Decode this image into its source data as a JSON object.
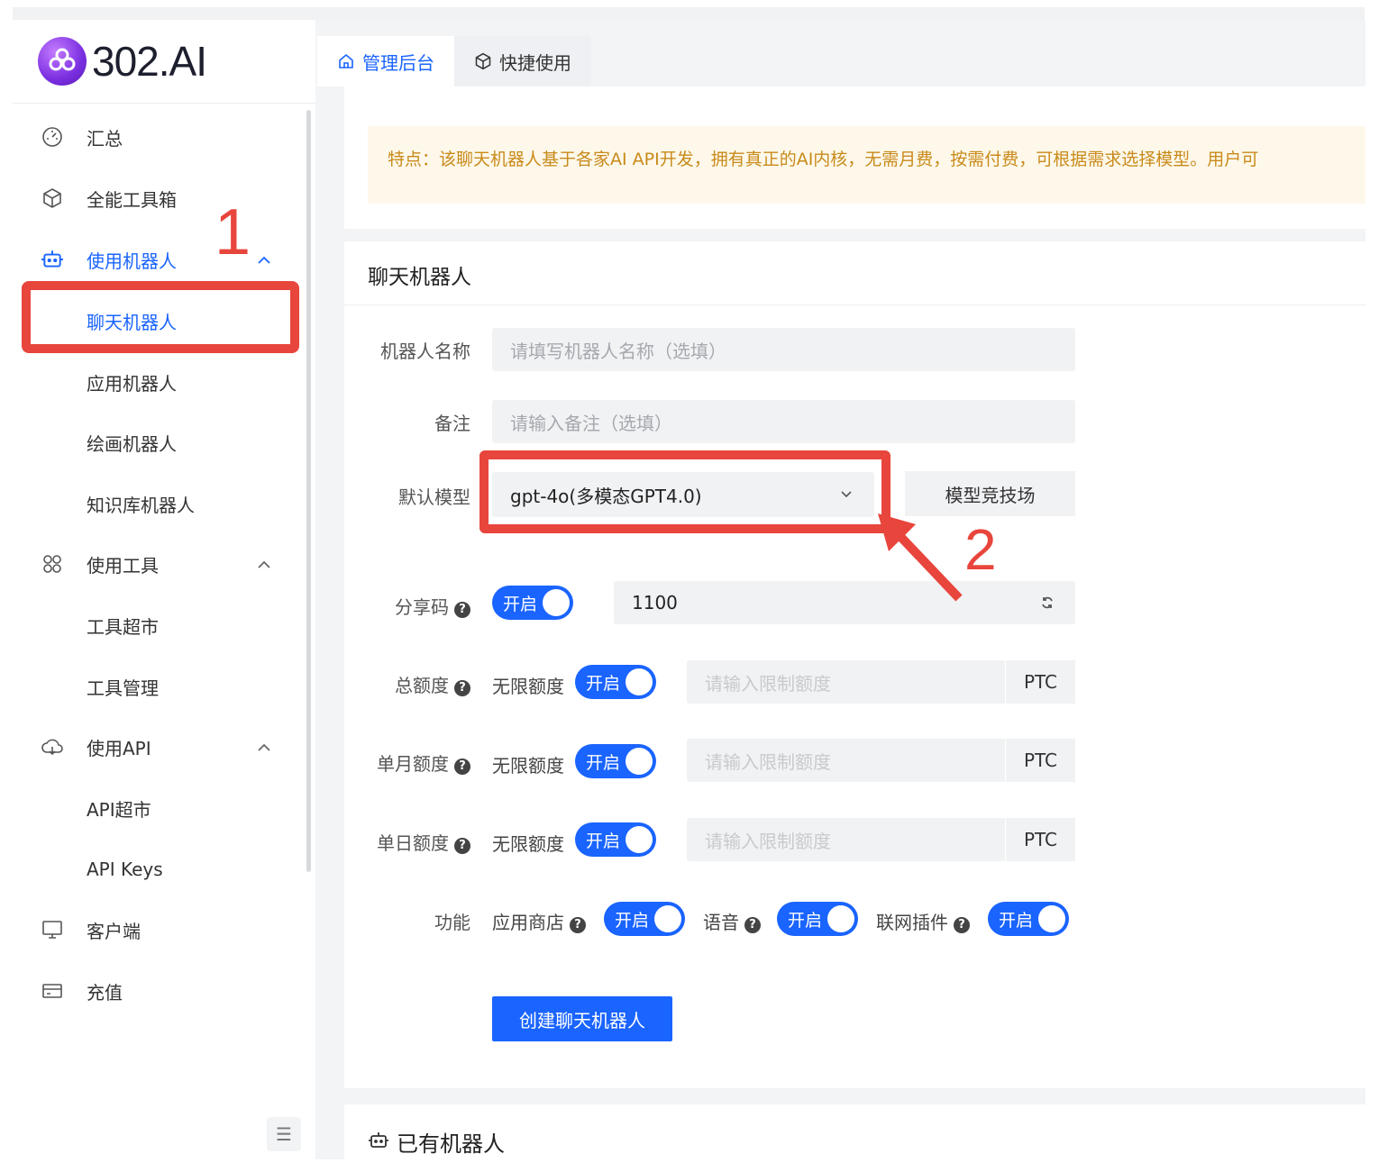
{
  "brand": {
    "name": "302.AI",
    "accent": "#1a64ff",
    "annotation_color": "#e8453c"
  },
  "header": {
    "tabs": [
      {
        "label": "管理后台",
        "icon": "home-icon",
        "active": true
      },
      {
        "label": "快捷使用",
        "icon": "cube-icon",
        "active": false
      }
    ]
  },
  "sidebar": {
    "items": [
      {
        "label": "汇总",
        "icon": "dashboard-icon"
      },
      {
        "label": "全能工具箱",
        "icon": "cube-icon"
      },
      {
        "label": "使用机器人",
        "icon": "robot-icon",
        "expanded": true
      },
      {
        "label": "聊天机器人",
        "child": true,
        "selected": true
      },
      {
        "label": "应用机器人",
        "child": true
      },
      {
        "label": "绘画机器人",
        "child": true
      },
      {
        "label": "知识库机器人",
        "child": true
      },
      {
        "label": "使用工具",
        "icon": "apps-icon",
        "expanded": true
      },
      {
        "label": "工具超市",
        "child": true
      },
      {
        "label": "工具管理",
        "child": true
      },
      {
        "label": "使用API",
        "icon": "cloud-icon",
        "expanded": true
      },
      {
        "label": "API超市",
        "child": true
      },
      {
        "label": "API Keys",
        "child": true
      },
      {
        "label": "客户端",
        "icon": "monitor-icon"
      },
      {
        "label": "充值",
        "icon": "card-icon"
      }
    ]
  },
  "annotations": {
    "one": "1",
    "two": "2"
  },
  "notice": {
    "text": "特点：该聊天机器人基于各家AI API开发，拥有真正的AI内核，无需月费，按需付费，可根据需求选择模型。用户可"
  },
  "form": {
    "title": "聊天机器人",
    "name_label": "机器人名称",
    "name_placeholder": "请填写机器人名称（选填）",
    "note_label": "备注",
    "note_placeholder": "请输入备注（选填）",
    "model_label": "默认模型",
    "model_value": "gpt-4o(多模态GPT4.0)",
    "arena_button": "模型竞技场",
    "share_label": "分享码",
    "share_toggle": "开启",
    "share_value": "1100",
    "total_label": "总额度",
    "monthly_label": "单月额度",
    "daily_label": "单日额度",
    "unlimited": "无限额度",
    "toggle_on": "开启",
    "limit_placeholder": "请输入限制额度",
    "unit": "PTC",
    "features_label": "功能",
    "features": [
      {
        "label": "应用商店",
        "toggle": "开启"
      },
      {
        "label": "语音",
        "toggle": "开启"
      },
      {
        "label": "联网插件",
        "toggle": "开启"
      }
    ],
    "submit": "创建聊天机器人"
  },
  "existing": {
    "title": "已有机器人"
  }
}
